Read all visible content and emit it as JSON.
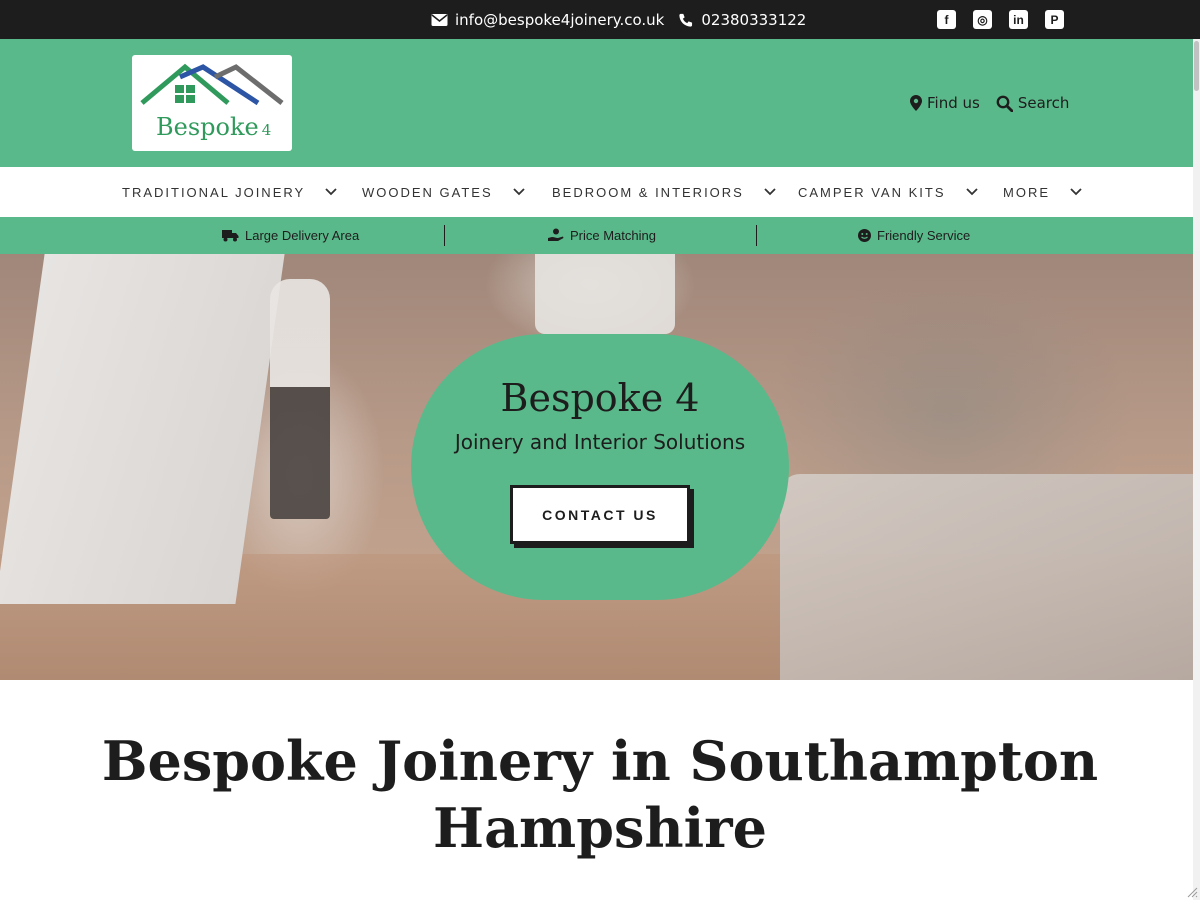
{
  "topbar": {
    "email": "info@bespoke4joinery.co.uk",
    "phone": "02380333122",
    "social": [
      {
        "name": "facebook-icon",
        "glyph": "f"
      },
      {
        "name": "instagram-icon",
        "glyph": "◎"
      },
      {
        "name": "linkedin-icon",
        "glyph": "in"
      },
      {
        "name": "pinterest-icon",
        "glyph": "P"
      }
    ]
  },
  "logo": {
    "text": "Bespoke",
    "number": "4"
  },
  "header": {
    "find_us": "Find us",
    "search": "Search"
  },
  "nav": {
    "items": [
      {
        "label": "TRADITIONAL JOINERY"
      },
      {
        "label": "WOODEN GATES"
      },
      {
        "label": "BEDROOM & INTERIORS"
      },
      {
        "label": "CAMPER VAN KITS"
      },
      {
        "label": "MORE"
      }
    ]
  },
  "usp": {
    "items": [
      {
        "label": "Large Delivery Area",
        "icon": "truck-icon"
      },
      {
        "label": "Price Matching",
        "icon": "hand-coin-icon"
      },
      {
        "label": "Friendly Service",
        "icon": "smile-icon"
      }
    ]
  },
  "hero": {
    "title": "Bespoke 4",
    "subtitle": "Joinery and Interior Solutions",
    "cta": "CONTACT US"
  },
  "heading": {
    "line1": "Bespoke Joinery in Southampton",
    "line2": "Hampshire"
  },
  "colors": {
    "brand_green": "#5ab98a",
    "dark": "#1d1d1d",
    "logo_green": "#2f9a5b",
    "logo_blue": "#2d55a5",
    "logo_grey": "#6d6d6d"
  }
}
